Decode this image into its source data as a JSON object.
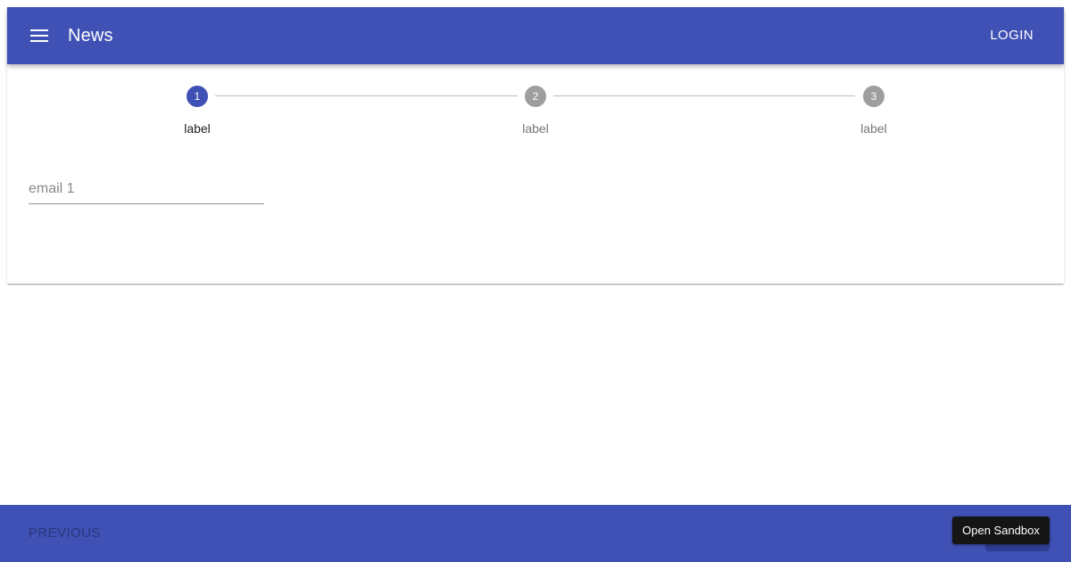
{
  "appbar": {
    "title": "News",
    "menu_icon": "menu-icon",
    "login_label": "LOGIN"
  },
  "stepper": {
    "active_index": 0,
    "steps": [
      {
        "number": "1",
        "label": "label",
        "state": "active"
      },
      {
        "number": "2",
        "label": "label",
        "state": "inactive"
      },
      {
        "number": "3",
        "label": "label",
        "state": "inactive"
      }
    ]
  },
  "form": {
    "email_placeholder": "email 1",
    "email_value": ""
  },
  "footer": {
    "previous_label": "PREVIOUS"
  },
  "sandbox": {
    "label": "Open Sandbox"
  },
  "colors": {
    "primary": "#3f51b5",
    "inactive_step": "#9e9e9e",
    "connector": "#bdbdbd"
  }
}
